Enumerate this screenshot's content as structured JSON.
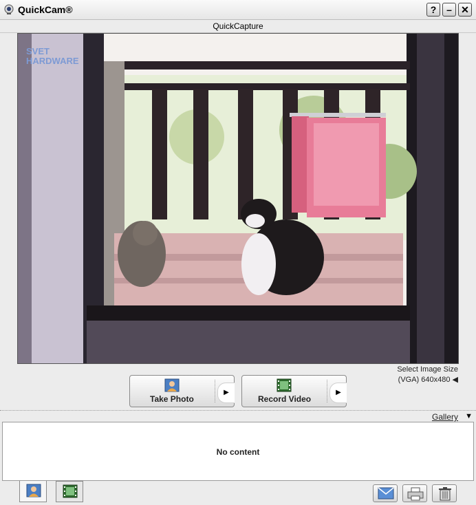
{
  "window": {
    "title": "QuickCam®",
    "help_label": "?",
    "minimize_label": "–",
    "close_label": "✕"
  },
  "header": {
    "title": "QuickCapture"
  },
  "preview": {
    "watermark_line1": "SVET",
    "watermark_line2": "HARDWARE"
  },
  "image_size": {
    "label": "Select Image Size",
    "value": "(VGA) 640x480 ◀"
  },
  "buttons": {
    "take_photo": "Take Photo",
    "record_video": "Record Video",
    "arrow": "▶"
  },
  "gallery": {
    "label": "Gallery",
    "arrow": "▼",
    "empty_text": "No content"
  },
  "icons": {
    "app": "webcam-icon",
    "photo": "user-photo-icon",
    "video": "film-strip-icon",
    "email": "envelope-icon",
    "print": "printer-icon",
    "delete": "trash-icon"
  },
  "colors": {
    "accent": "#3b6fb5",
    "panel": "#ffffff",
    "chrome": "#ececec"
  }
}
